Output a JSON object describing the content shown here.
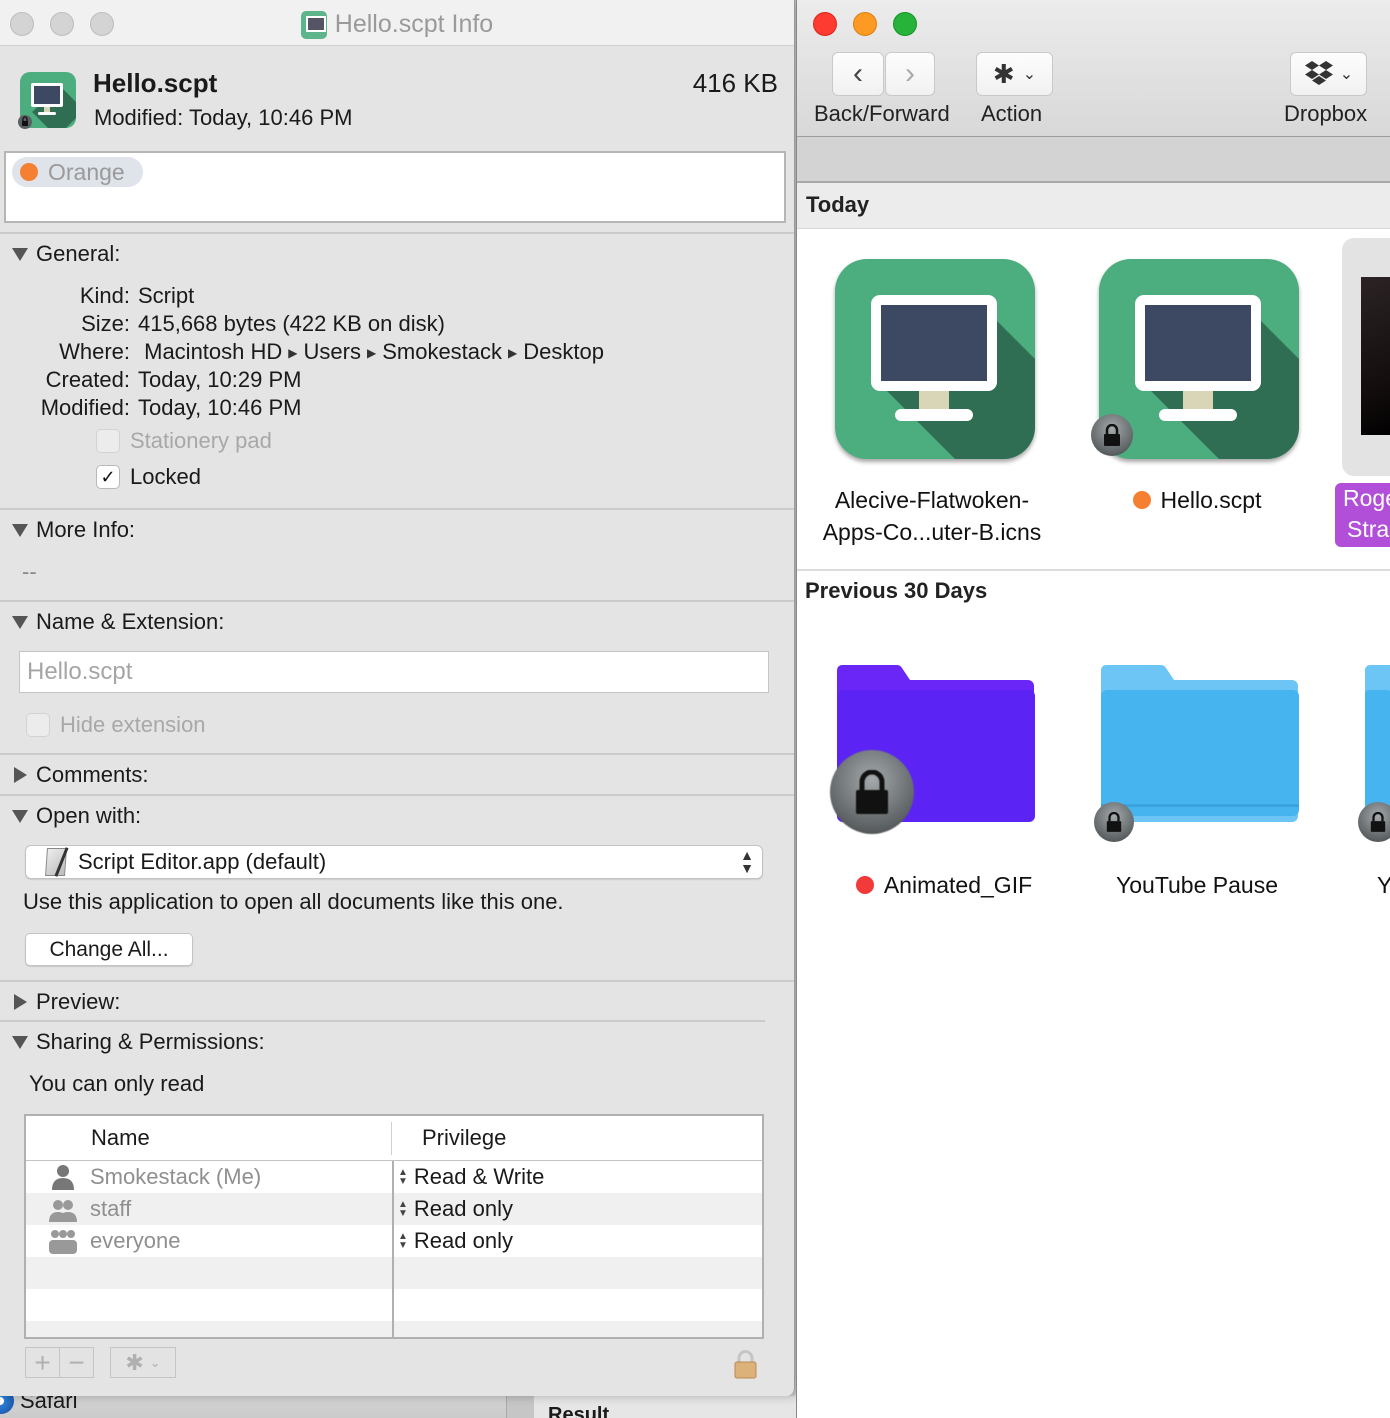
{
  "background": {
    "dock_app_label": "Safari",
    "result_label": "Result"
  },
  "info_window": {
    "title": "Hello.scpt Info",
    "file": {
      "name": "Hello.scpt",
      "size": "416 KB",
      "modified_line": "Modified: Today, 10:46 PM"
    },
    "tags": [
      {
        "label": "Orange",
        "color": "#f68032"
      }
    ],
    "sections": {
      "general": {
        "title": "General:",
        "expanded": true,
        "fields": [
          {
            "key": "Kind:",
            "value": "Script"
          },
          {
            "key": "Size:",
            "value": "415,668 bytes (422 KB on disk)"
          },
          {
            "key": "Where:",
            "path": [
              "Macintosh HD",
              "Users",
              "Smokestack",
              "Desktop"
            ]
          },
          {
            "key": "Created:",
            "value": "Today, 10:29 PM"
          },
          {
            "key": "Modified:",
            "value": "Today, 10:46 PM"
          }
        ],
        "stationery_pad": {
          "label": "Stationery pad",
          "checked": false,
          "enabled": false
        },
        "locked": {
          "label": "Locked",
          "checked": true,
          "enabled": true
        }
      },
      "more_info": {
        "title": "More Info:",
        "expanded": true,
        "value": "--"
      },
      "name_extension": {
        "title": "Name & Extension:",
        "expanded": true,
        "name_value": "Hello.scpt",
        "hide_extension": {
          "label": "Hide extension",
          "checked": false,
          "enabled": false
        }
      },
      "comments": {
        "title": "Comments:",
        "expanded": false
      },
      "open_with": {
        "title": "Open with:",
        "expanded": true,
        "selected_app": "Script Editor.app (default)",
        "helper_text": "Use this application to open all documents like this one.",
        "change_all_label": "Change All..."
      },
      "preview": {
        "title": "Preview:",
        "expanded": false
      },
      "sharing": {
        "title": "Sharing & Permissions:",
        "expanded": true,
        "note": "You can only read",
        "columns": [
          "Name",
          "Privilege"
        ],
        "rows": [
          {
            "name": "Smokestack (Me)",
            "icon": "user-icon",
            "privilege": "Read & Write"
          },
          {
            "name": "staff",
            "icon": "group-icon",
            "privilege": "Read only"
          },
          {
            "name": "everyone",
            "icon": "everyone-icon",
            "privilege": "Read only"
          }
        ],
        "add_label": "+",
        "remove_label": "−"
      }
    }
  },
  "finder": {
    "toolbar": {
      "back_forward_label": "Back/Forward",
      "action_label": "Action",
      "dropbox_label": "Dropbox"
    },
    "groups": [
      {
        "title": "Today",
        "items": [
          {
            "name_line1": "Alecive-Flatwoken-",
            "name_line2": "Apps-Co...uter-B.icns",
            "tag_color": null
          },
          {
            "name": "Hello.scpt",
            "tag_color": "#f68032",
            "locked": true
          },
          {
            "name_line1": "Roge",
            "name_line2": "Stra",
            "selected": true
          }
        ]
      },
      {
        "title": "Previous 30 Days",
        "items": [
          {
            "name": "Animated_GIF",
            "tag_color": "#f23a3a",
            "locked": true,
            "folder_color": "#5b24f5"
          },
          {
            "name": "YouTube Pause",
            "tag_color": null,
            "locked": true,
            "folder_color": "#4ab8f0"
          },
          {
            "name": "Y",
            "locked": true,
            "folder_color": "#4ab8f0"
          }
        ]
      }
    ]
  }
}
